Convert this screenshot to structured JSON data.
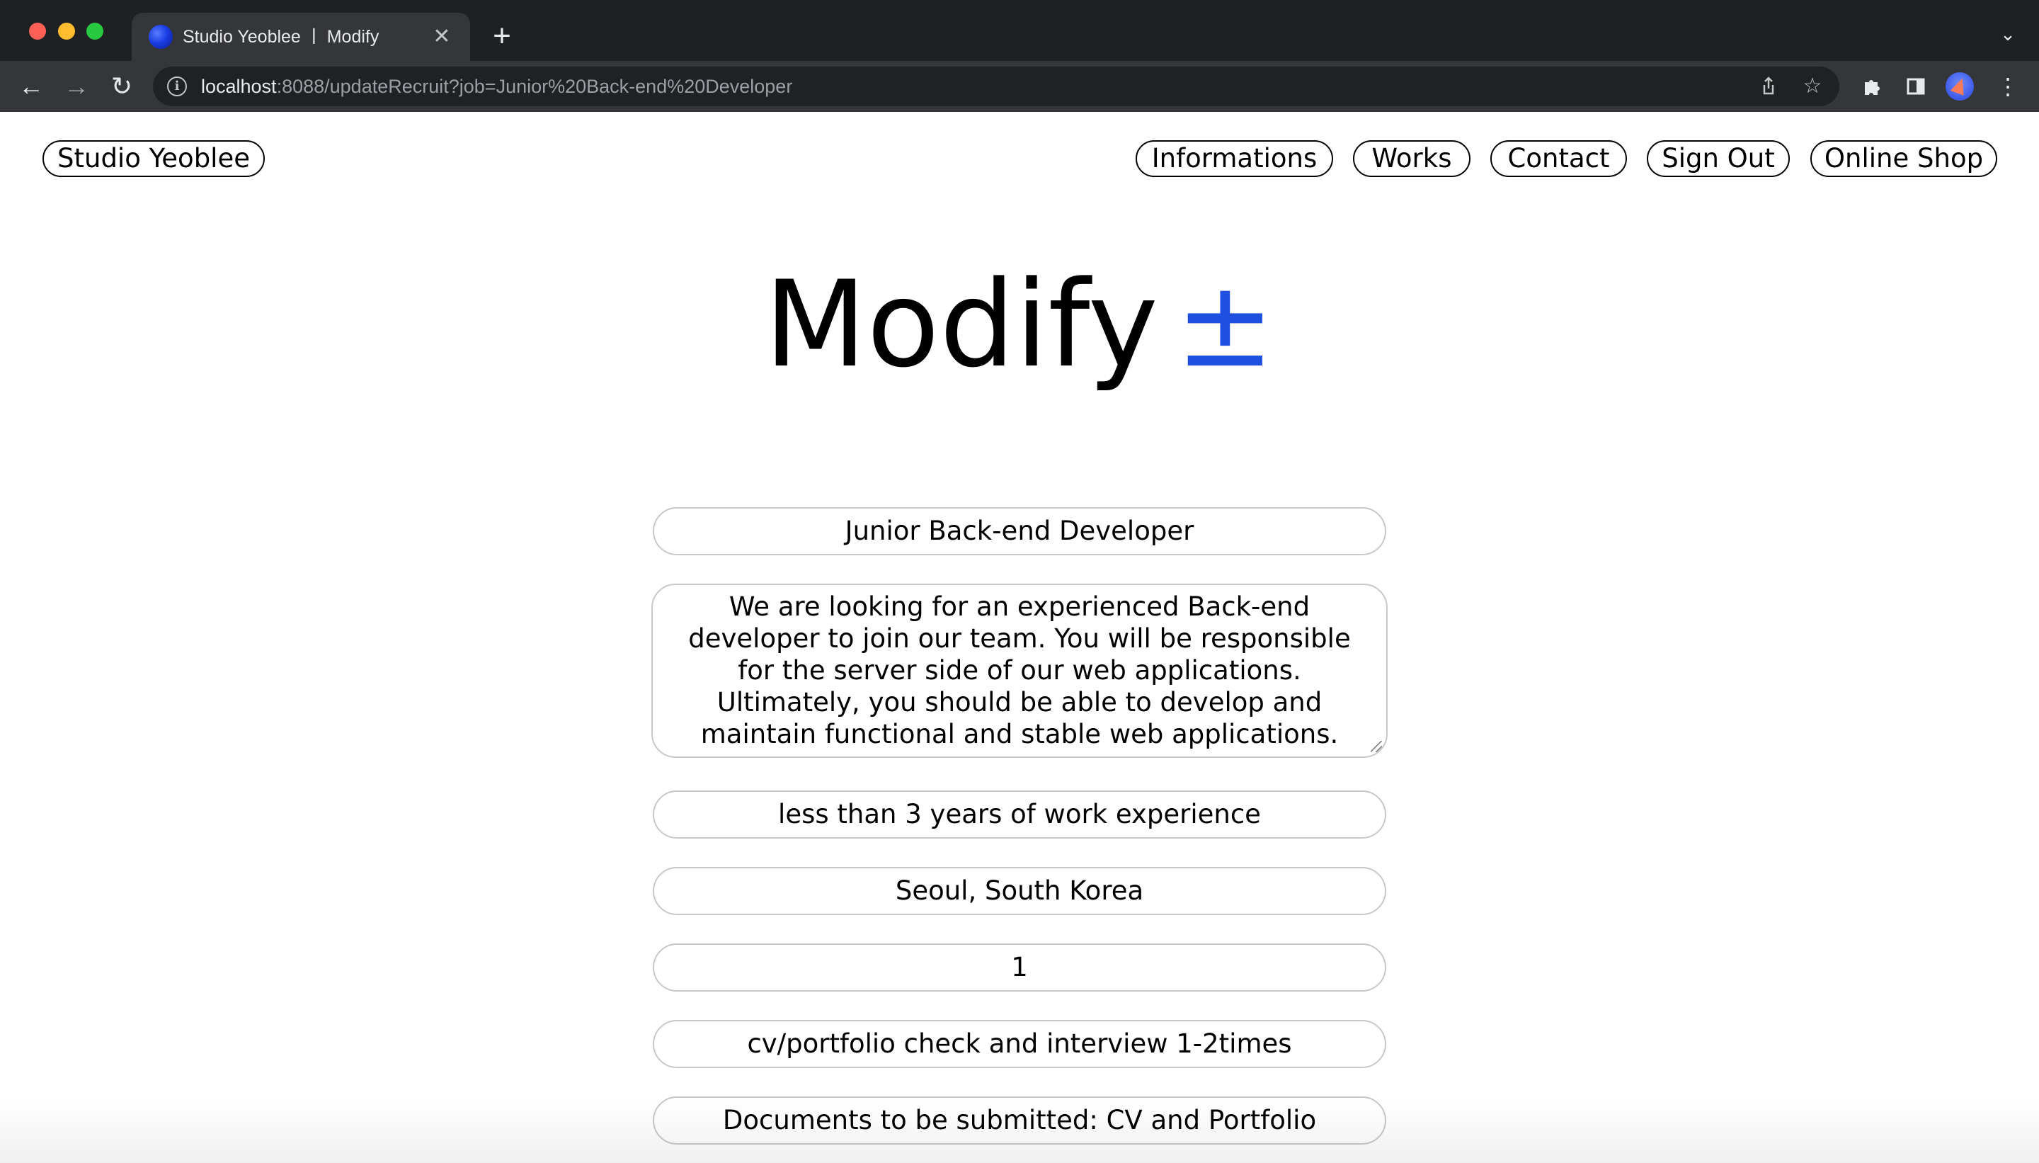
{
  "browser": {
    "tab_title": "Studio Yeoblee ㅣ Modify",
    "tab_close": "✕",
    "new_tab": "+",
    "url_host": "localhost",
    "url_rest": ":8088/updateRecruit?job=Junior%20Back-end%20Developer",
    "icons": {
      "back": "back-arrow-icon",
      "forward": "forward-arrow-icon",
      "reload": "reload-icon",
      "info": "info-icon",
      "share": "share-icon",
      "bookmark": "star-icon",
      "extensions": "puzzle-icon",
      "side_panel": "side-panel-icon",
      "menu": "kebab-menu-icon",
      "tab_search": "chevron-down-icon"
    }
  },
  "header": {
    "brand": "Studio Yeoblee",
    "nav": {
      "informations": "Informations",
      "works": "Works",
      "contact": "Contact",
      "sign_out": "Sign Out",
      "online_shop": "Online Shop"
    }
  },
  "main": {
    "title": "Modify",
    "title_symbol": "±",
    "accent_color": "#1f4fe0",
    "form": {
      "job_title": "Junior Back-end Developer",
      "description": "We are looking for an experienced Back-end developer to join our team. You will be responsible for the server side of our web applications. Ultimately, you should be able to develop and maintain functional and stable web applications.",
      "experience": "less than 3 years of work experience",
      "location": "Seoul, South Korea",
      "headcount": "1",
      "process": "cv/portfolio check and interview 1-2times",
      "documents": "Documents to be submitted: CV and Portfolio"
    }
  }
}
